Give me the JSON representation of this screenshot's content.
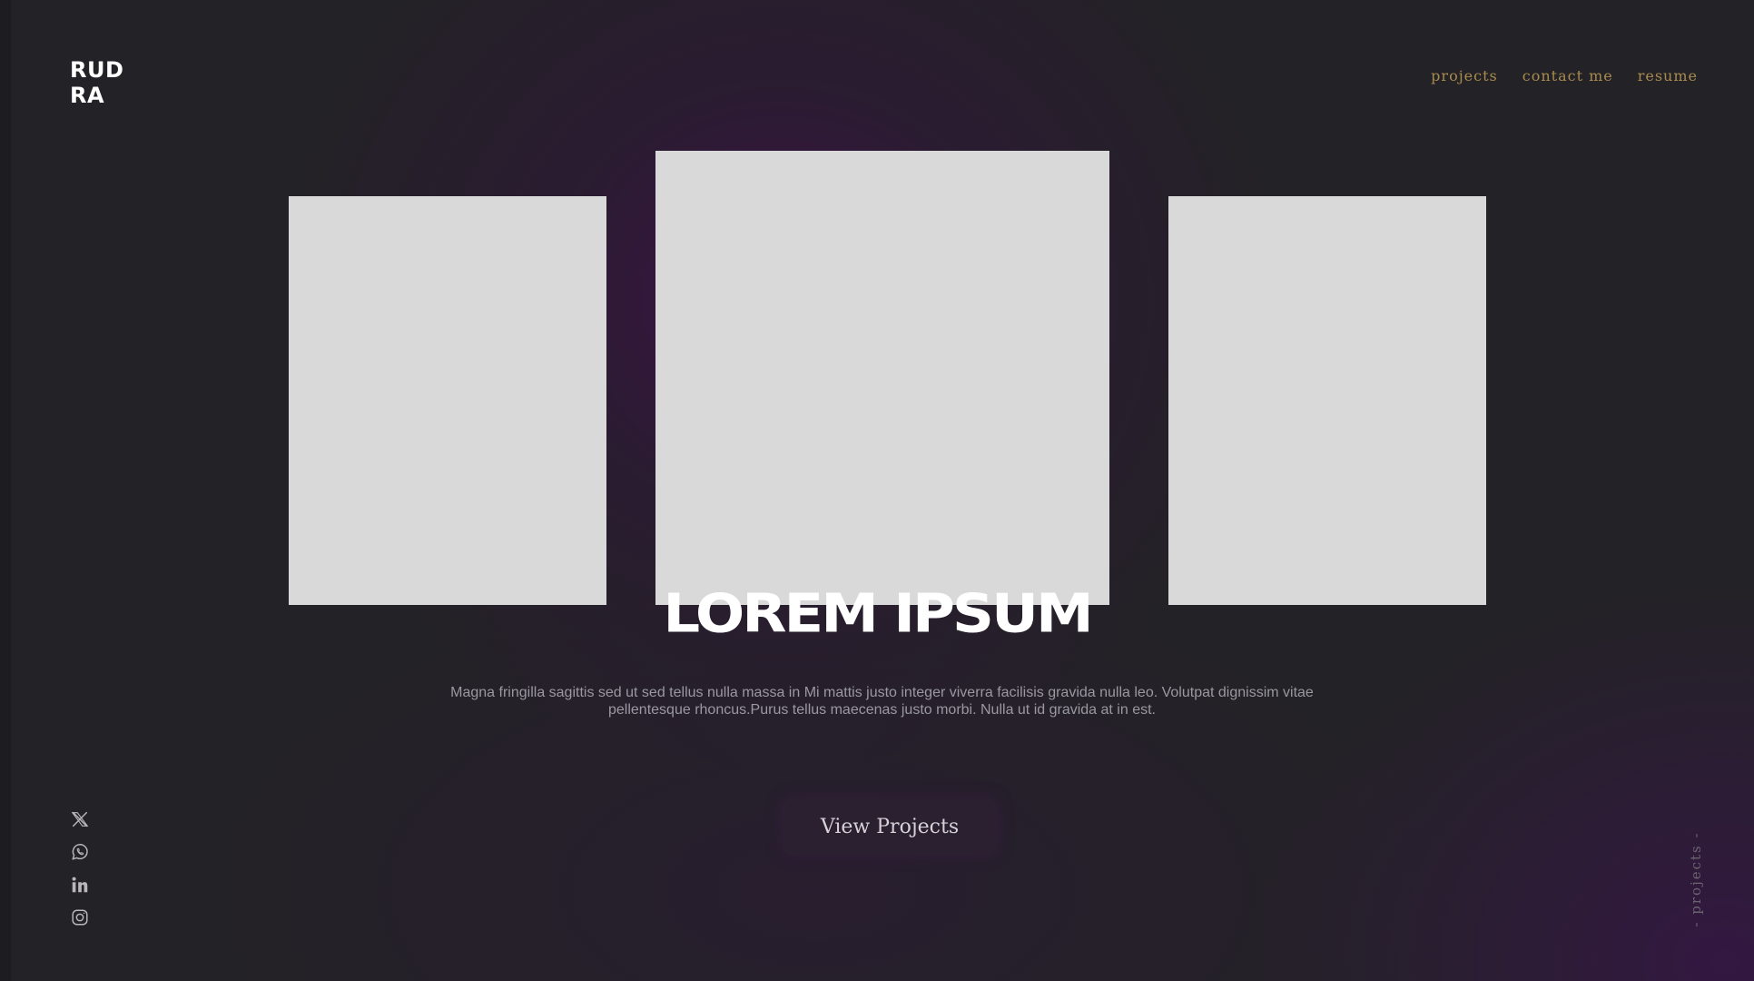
{
  "logo": {
    "line1": "RUD",
    "line2": "RA"
  },
  "nav": {
    "items": [
      {
        "label": "projects"
      },
      {
        "label": "contact me"
      },
      {
        "label": "resume"
      }
    ]
  },
  "hero": {
    "title": "LOREM IPSUM",
    "description": "Magna fringilla sagittis sed ut sed tellus nulla massa in Mi mattis justo integer viverra facilisis gravida nulla leo. Volutpat dignissim vitae pellentesque rhoncus.Purus tellus maecenas justo morbi. Nulla ut id gravida at in est.",
    "cta_label": "View Projects"
  },
  "socials": [
    {
      "icon": "x-twitter-icon"
    },
    {
      "icon": "whatsapp-icon"
    },
    {
      "icon": "linkedin-icon"
    },
    {
      "icon": "instagram-icon"
    }
  ],
  "side_label": "- projects -",
  "colors": {
    "background": "#232226",
    "accent_purple": "#3a1548",
    "nav_gold": "#a98a4f",
    "card_placeholder": "#d9d9d9",
    "text_white": "#ffffff",
    "text_muted": "#9a98a0"
  }
}
